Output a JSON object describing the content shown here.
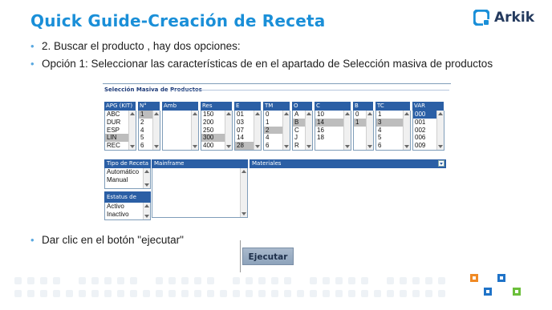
{
  "slide": {
    "title": "Quick Guide-Creación de Receta",
    "logo_text": "Arkik",
    "bullet1": "2. Buscar el producto , hay dos opciones:",
    "bullet2": "Opción 1: Seleccionar las características de en el apartado de Selección masiva de productos",
    "bullet3": "Dar clic en el botón \"ejecutar\""
  },
  "panel": {
    "title": "Selección Masiva de Productos",
    "columns": [
      {
        "header": "APG (KIT)",
        "items": [
          "ABC",
          "DUR",
          "ESP",
          "LIN",
          "REC"
        ],
        "selected": [
          3
        ]
      },
      {
        "header": "N°",
        "items": [
          "1",
          "2",
          "4",
          "5",
          "6"
        ],
        "selected": [
          0
        ]
      },
      {
        "header": "Amb",
        "items": [],
        "selected": []
      },
      {
        "header": "Res",
        "items": [
          "150",
          "200",
          "250",
          "300",
          "400"
        ],
        "selected": [
          3
        ]
      },
      {
        "header": "E",
        "items": [
          "01",
          "03",
          "07",
          "14",
          "28"
        ],
        "selected": [
          4
        ]
      },
      {
        "header": "TM",
        "items": [
          "0",
          "1",
          "2",
          "4",
          "6"
        ],
        "selected": [
          2
        ]
      },
      {
        "header": "O",
        "items": [
          "A",
          "B",
          "C",
          "J",
          "R"
        ],
        "selected": [
          1
        ]
      },
      {
        "header": "C",
        "items": [
          "10",
          "14",
          "16",
          "18"
        ],
        "selected": [
          1
        ]
      },
      {
        "header": "B",
        "items": [
          "0",
          "1"
        ],
        "selected": [
          1
        ]
      },
      {
        "header": "TC",
        "items": [
          "1",
          "3",
          "4",
          "5",
          "6"
        ],
        "selected": [
          1
        ]
      },
      {
        "header": "VAR",
        "items": [
          "000",
          "001",
          "002",
          "006",
          "009"
        ],
        "selected": [
          0
        ]
      }
    ],
    "tipo_receta": {
      "header": "Tipo de Receta",
      "items": [
        "Automático",
        "Manual"
      ]
    },
    "mainframe": {
      "header": "Mainframe"
    },
    "materiales": {
      "header": "Materiales"
    },
    "estatus": {
      "header": "Estatus de Recet",
      "items": [
        "Activo",
        "Inactivo"
      ]
    }
  },
  "execute_button": "Ejecutar",
  "colors": {
    "title": "#1a8fd8",
    "bullet": "#5aa8e0",
    "header_bar": "#2b5fa5",
    "orange": "#f08a24",
    "blue": "#1f73c8",
    "green": "#6bbf3a"
  }
}
